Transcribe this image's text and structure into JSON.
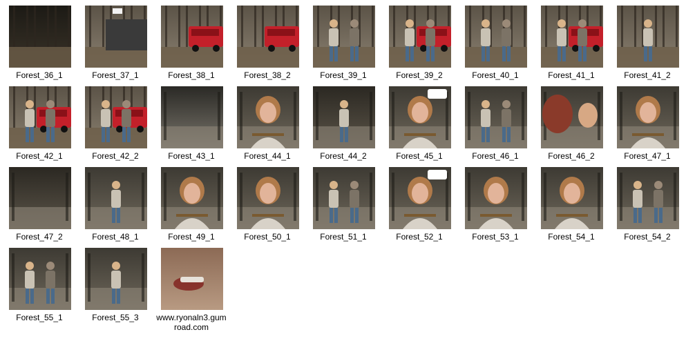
{
  "files": [
    {
      "name": "Forest_36_1",
      "scene": "forest-dark"
    },
    {
      "name": "Forest_37_1",
      "scene": "forest-truck-white"
    },
    {
      "name": "Forest_38_1",
      "scene": "forest-red-truck-side"
    },
    {
      "name": "Forest_38_2",
      "scene": "forest-red-truck"
    },
    {
      "name": "Forest_39_1",
      "scene": "forest-figures"
    },
    {
      "name": "Forest_39_2",
      "scene": "forest-red-truck-figures"
    },
    {
      "name": "Forest_40_1",
      "scene": "forest-figures"
    },
    {
      "name": "Forest_41_1",
      "scene": "forest-red-truck-figures"
    },
    {
      "name": "Forest_41_2",
      "scene": "forest-ground"
    },
    {
      "name": "Forest_42_1",
      "scene": "forest-red-truck-figures"
    },
    {
      "name": "Forest_42_2",
      "scene": "forest-red-truck-figures"
    },
    {
      "name": "Forest_43_1",
      "scene": "room-gray"
    },
    {
      "name": "Forest_44_1",
      "scene": "room-portrait"
    },
    {
      "name": "Forest_44_2",
      "scene": "room-dark-figure"
    },
    {
      "name": "Forest_45_1",
      "scene": "room-portrait-bubble"
    },
    {
      "name": "Forest_46_1",
      "scene": "room-figures"
    },
    {
      "name": "Forest_46_2",
      "scene": "room-closeup"
    },
    {
      "name": "Forest_47_1",
      "scene": "room-portrait"
    },
    {
      "name": "Forest_47_2",
      "scene": "room-dark"
    },
    {
      "name": "Forest_48_1",
      "scene": "room-figure"
    },
    {
      "name": "Forest_49_1",
      "scene": "room-portrait"
    },
    {
      "name": "Forest_50_1",
      "scene": "room-portrait"
    },
    {
      "name": "Forest_51_1",
      "scene": "room-figures"
    },
    {
      "name": "Forest_52_1",
      "scene": "room-portrait-bubble"
    },
    {
      "name": "Forest_53_1",
      "scene": "room-portrait"
    },
    {
      "name": "Forest_54_1",
      "scene": "room-portrait"
    },
    {
      "name": "Forest_54_2",
      "scene": "room-figures"
    },
    {
      "name": "Forest_55_1",
      "scene": "room-figures"
    },
    {
      "name": "Forest_55_3",
      "scene": "room-figure"
    },
    {
      "name": "www.ryonaln3.gumroad.com",
      "scene": "red-floor"
    }
  ],
  "colors": {
    "background": "#ffffff",
    "label_text": "#000000"
  }
}
